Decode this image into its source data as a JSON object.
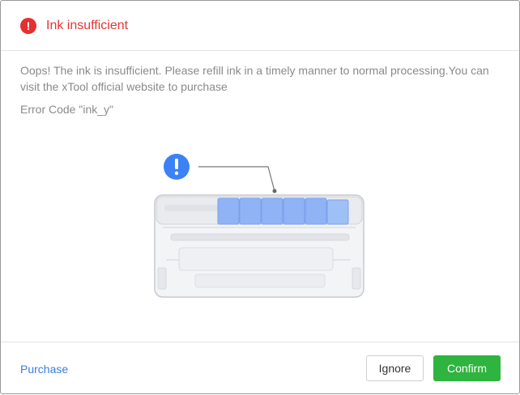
{
  "dialog": {
    "title": "Ink insufficient",
    "title_icon": "error-icon",
    "message": "Oops! The ink is insufficient. Please refill ink in a timely manner to normal processing.You can visit the xTool official website to purchase",
    "error_code": "Error Code \"ink_y\"",
    "illustration_icon": "exclamation-icon"
  },
  "footer": {
    "purchase_label": "Purchase",
    "ignore_label": "Ignore",
    "confirm_label": "Confirm"
  },
  "colors": {
    "error": "#e63030",
    "link": "#3b7ddd",
    "confirm": "#2fb43f",
    "ink_cartridge": "#8fb3f5"
  }
}
